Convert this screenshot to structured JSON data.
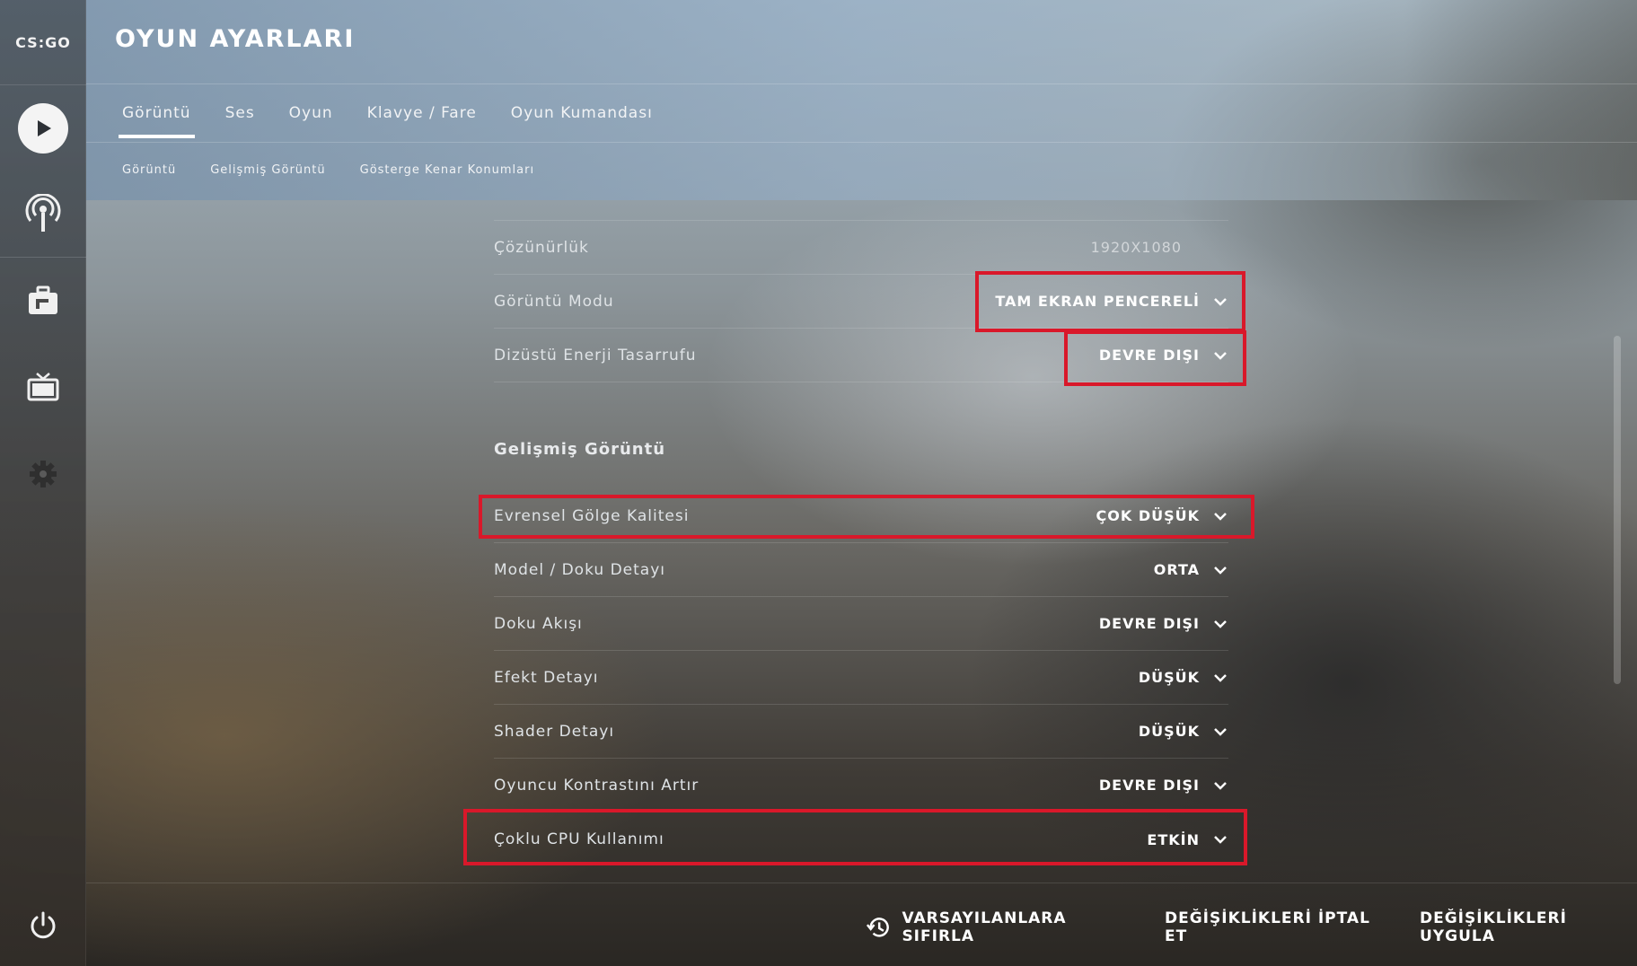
{
  "app": {
    "logo_text": "CS:GO",
    "title": "OYUN AYARLARI"
  },
  "sidebar": {
    "items": [
      {
        "icon": "play-icon"
      },
      {
        "icon": "broadcast-icon"
      },
      {
        "icon": "inventory-icon"
      },
      {
        "icon": "tv-icon"
      },
      {
        "icon": "gear-icon"
      },
      {
        "icon": "power-icon"
      }
    ]
  },
  "tabs": [
    "Görüntü",
    "Ses",
    "Oyun",
    "Klavye / Fare",
    "Oyun Kumandası"
  ],
  "active_tab": "Görüntü",
  "subtabs": [
    "Görüntü",
    "Gelişmiş Görüntü",
    "Gösterge Kenar Konumları"
  ],
  "settings": {
    "resolution": {
      "label": "Çözünürlük",
      "value": "1920X1080"
    },
    "display_mode": {
      "label": "Görüntü Modu",
      "value": "TAM EKRAN PENCERELİ"
    },
    "laptop_power": {
      "label": "Dizüstü Enerji Tasarrufu",
      "value": "DEVRE DIŞI"
    },
    "advanced_title": "Gelişmiş Görüntü",
    "shadow_quality": {
      "label": "Evrensel Gölge Kalitesi",
      "value": "ÇOK DÜŞÜK"
    },
    "model_texture": {
      "label": "Model / Doku Detayı",
      "value": "ORTA"
    },
    "texture_streaming": {
      "label": "Doku Akışı",
      "value": "DEVRE DIŞI"
    },
    "effect_detail": {
      "label": "Efekt Detayı",
      "value": "DÜŞÜK"
    },
    "shader_detail": {
      "label": "Shader Detayı",
      "value": "DÜŞÜK"
    },
    "player_contrast": {
      "label": "Oyuncu Kontrastını Artır",
      "value": "DEVRE DIŞI"
    },
    "multicore": {
      "label": "Çoklu CPU Kullanımı",
      "value": "ETKİN"
    }
  },
  "footer": {
    "reset": "VARSAYILANLARA SIFIRLA",
    "cancel": "DEĞİŞİKLİKLERİ İPTAL ET",
    "apply": "DEĞİŞİKLİKLERİ UYGULA"
  },
  "colors": {
    "highlight": "#d9182a",
    "text": "#ffffff"
  }
}
